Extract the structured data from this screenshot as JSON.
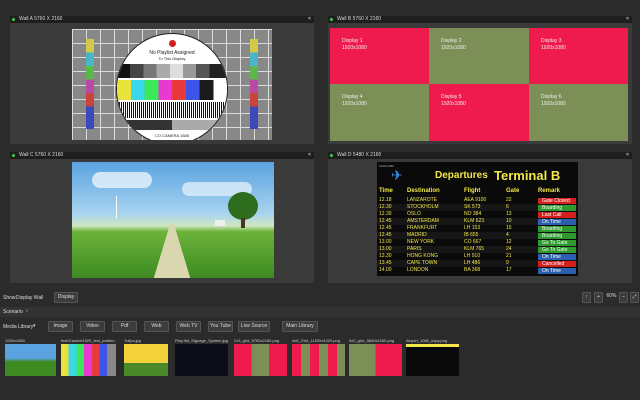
{
  "walls": [
    {
      "title": "Wall A 5760 X 2160"
    },
    {
      "title": "Wall B 5760 X 2160"
    },
    {
      "title": "Wall C 5760 X 2160"
    },
    {
      "title": "Wall D 5480 X 2160"
    }
  ],
  "testpattern": {
    "line1": "No Playlist Assigned",
    "line2": "To This Display",
    "brand": "CO CAMERA 1685"
  },
  "displays": [
    {
      "name": "Display 1",
      "res": "1920x1080"
    },
    {
      "name": "Display 2",
      "res": "1920x1080"
    },
    {
      "name": "Display 3",
      "res": "1920x1080"
    },
    {
      "name": "Display 4",
      "res": "1920x1080"
    },
    {
      "name": "Display 5",
      "res": "1920x1080"
    },
    {
      "name": "Display 6",
      "res": "1920x1080"
    }
  ],
  "departures": {
    "small_text": "1920x1080",
    "heading": "Departures",
    "terminal": "Terminal B",
    "columns": [
      "Time",
      "Destination",
      "Flight",
      "Gate",
      "Remark"
    ],
    "rows": [
      {
        "time": "12.18",
        "dest": "LANZAROTE",
        "flight": "AEA 9100",
        "gate": "22",
        "remark": "Gate Closed",
        "color": "#d41f1f"
      },
      {
        "time": "12.30",
        "dest": "STOCKHOLM",
        "flight": "SK 573",
        "gate": "6",
        "remark": "Boarding",
        "color": "#2e9a2e"
      },
      {
        "time": "12.30",
        "dest": "OSLO",
        "flight": "NO 384",
        "gate": "13",
        "remark": "Last Call",
        "color": "#d41f1f"
      },
      {
        "time": "12.45",
        "dest": "AMSTERDAM",
        "flight": "KLM 623",
        "gate": "10",
        "remark": "On Time",
        "color": "#2c5fb0"
      },
      {
        "time": "12.45",
        "dest": "FRANKFURT",
        "flight": "LH 153",
        "gate": "15",
        "remark": "Boarding",
        "color": "#2e9a2e"
      },
      {
        "time": "12.45",
        "dest": "MADRID",
        "flight": "IB 655",
        "gate": "4",
        "remark": "Boarding",
        "color": "#2e9a2e"
      },
      {
        "time": "13.00",
        "dest": "NEW YORK",
        "flight": "CO 667",
        "gate": "12",
        "remark": "Go To Gate",
        "color": "#2e9a2e"
      },
      {
        "time": "13.00",
        "dest": "PARIS",
        "flight": "KLM 765",
        "gate": "24",
        "remark": "Go To Gate",
        "color": "#2e9a2e"
      },
      {
        "time": "13.30",
        "dest": "HONG KONG",
        "flight": "LH 910",
        "gate": "21",
        "remark": "On Time",
        "color": "#2c5fb0"
      },
      {
        "time": "13.45",
        "dest": "CAPE TOWN",
        "flight": "LH 486",
        "gate": "9",
        "remark": "Cancelled",
        "color": "#d41f1f"
      },
      {
        "time": "14.00",
        "dest": "LONDON",
        "flight": "BA 368",
        "gate": "17",
        "remark": "On Time",
        "color": "#2c5fb0"
      }
    ]
  },
  "show_bar": {
    "show_label": "Show",
    "show_value": "Display Wall",
    "display_btn": "Display",
    "zoom": "60%"
  },
  "scenario_label": "Scenario",
  "library": {
    "label": "Media Library",
    "tabs": [
      "Image",
      "Video",
      "Pdf",
      "Web",
      "Web TV",
      "You Tube",
      "Live Source",
      "Main Library"
    ]
  },
  "thumbs": [
    {
      "label": "1920x1080"
    },
    {
      "label": "testChannel1920_test_pattern_f1..."
    },
    {
      "label": "Tulips.jpg"
    },
    {
      "label": "Play-list_Signage_System.jpg"
    },
    {
      "label": "2x3_grid_5760x2160.png"
    },
    {
      "label": "4x6_Grid_11520x4320.png"
    },
    {
      "label": "3x2_grid_5840x2160.png"
    },
    {
      "label": "Airport_1080_copy.png"
    }
  ],
  "colors": {
    "wall_red": "#ef1a4e",
    "wall_green": "#7b8f57"
  }
}
